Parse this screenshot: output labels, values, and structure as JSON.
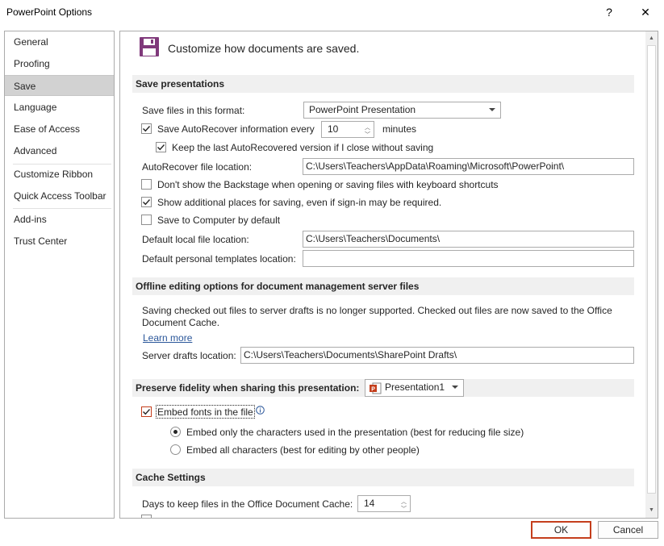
{
  "window": {
    "title": "PowerPoint Options",
    "help_glyph": "?",
    "close_glyph": "✕"
  },
  "sidebar": {
    "items": [
      {
        "label": "General"
      },
      {
        "label": "Proofing"
      },
      {
        "label": "Save"
      },
      {
        "label": "Language"
      },
      {
        "label": "Ease of Access"
      },
      {
        "label": "Advanced"
      },
      {
        "label": "Customize Ribbon"
      },
      {
        "label": "Quick Access Toolbar"
      },
      {
        "label": "Add-ins"
      },
      {
        "label": "Trust Center"
      }
    ]
  },
  "main": {
    "header": "Customize how documents are saved.",
    "save_presentations": {
      "heading": "Save presentations",
      "format_label": "Save files in this format:",
      "format_value": "PowerPoint Presentation",
      "autorecover_label": "Save AutoRecover information every",
      "autorecover_checked": true,
      "autorecover_minutes": "10",
      "minutes_label": "minutes",
      "keep_last_label": "Keep the last AutoRecovered version if I close without saving",
      "keep_last_checked": true,
      "autorecover_location_label": "AutoRecover file location:",
      "autorecover_location_value": "C:\\Users\\Teachers\\AppData\\Roaming\\Microsoft\\PowerPoint\\",
      "dont_show_backstage_label": "Don't show the Backstage when opening or saving files with keyboard shortcuts",
      "dont_show_backstage_checked": false,
      "show_additional_label": "Show additional places for saving, even if sign-in may be required.",
      "show_additional_checked": true,
      "save_to_computer_label": "Save to Computer by default",
      "save_to_computer_checked": false,
      "default_local_label": "Default local file location:",
      "default_local_value": "C:\\Users\\Teachers\\Documents\\",
      "default_templates_label": "Default personal templates location:",
      "default_templates_value": ""
    },
    "offline": {
      "heading": "Offline editing options for document management server files",
      "description_line1": "Saving checked out files to server drafts is no longer supported. Checked out files are now saved to the Office",
      "description_line2": "Document Cache.",
      "learn_more": "Learn more",
      "server_drafts_label": "Server drafts location:",
      "server_drafts_value": "C:\\Users\\Teachers\\Documents\\SharePoint Drafts\\"
    },
    "fidelity": {
      "heading": "Preserve fidelity when sharing this presentation:",
      "presentation_value": "Presentation1",
      "embed_fonts_label": "Embed fonts in the file",
      "embed_fonts_checked": true,
      "embed_only_label": "Embed only the characters used in the presentation (best for reducing file size)",
      "embed_all_label": "Embed all characters (best for editing by other people)",
      "selected_option": "embed_only"
    },
    "cache": {
      "heading": "Cache Settings",
      "days_label": "Days to keep files in the Office Document Cache:",
      "days_value": "14"
    }
  },
  "footer": {
    "ok_label": "OK",
    "cancel_label": "Cancel"
  },
  "colors": {
    "accent_border": "#c43e1c",
    "link": "#2b579a",
    "save_icon": "#80397b"
  }
}
